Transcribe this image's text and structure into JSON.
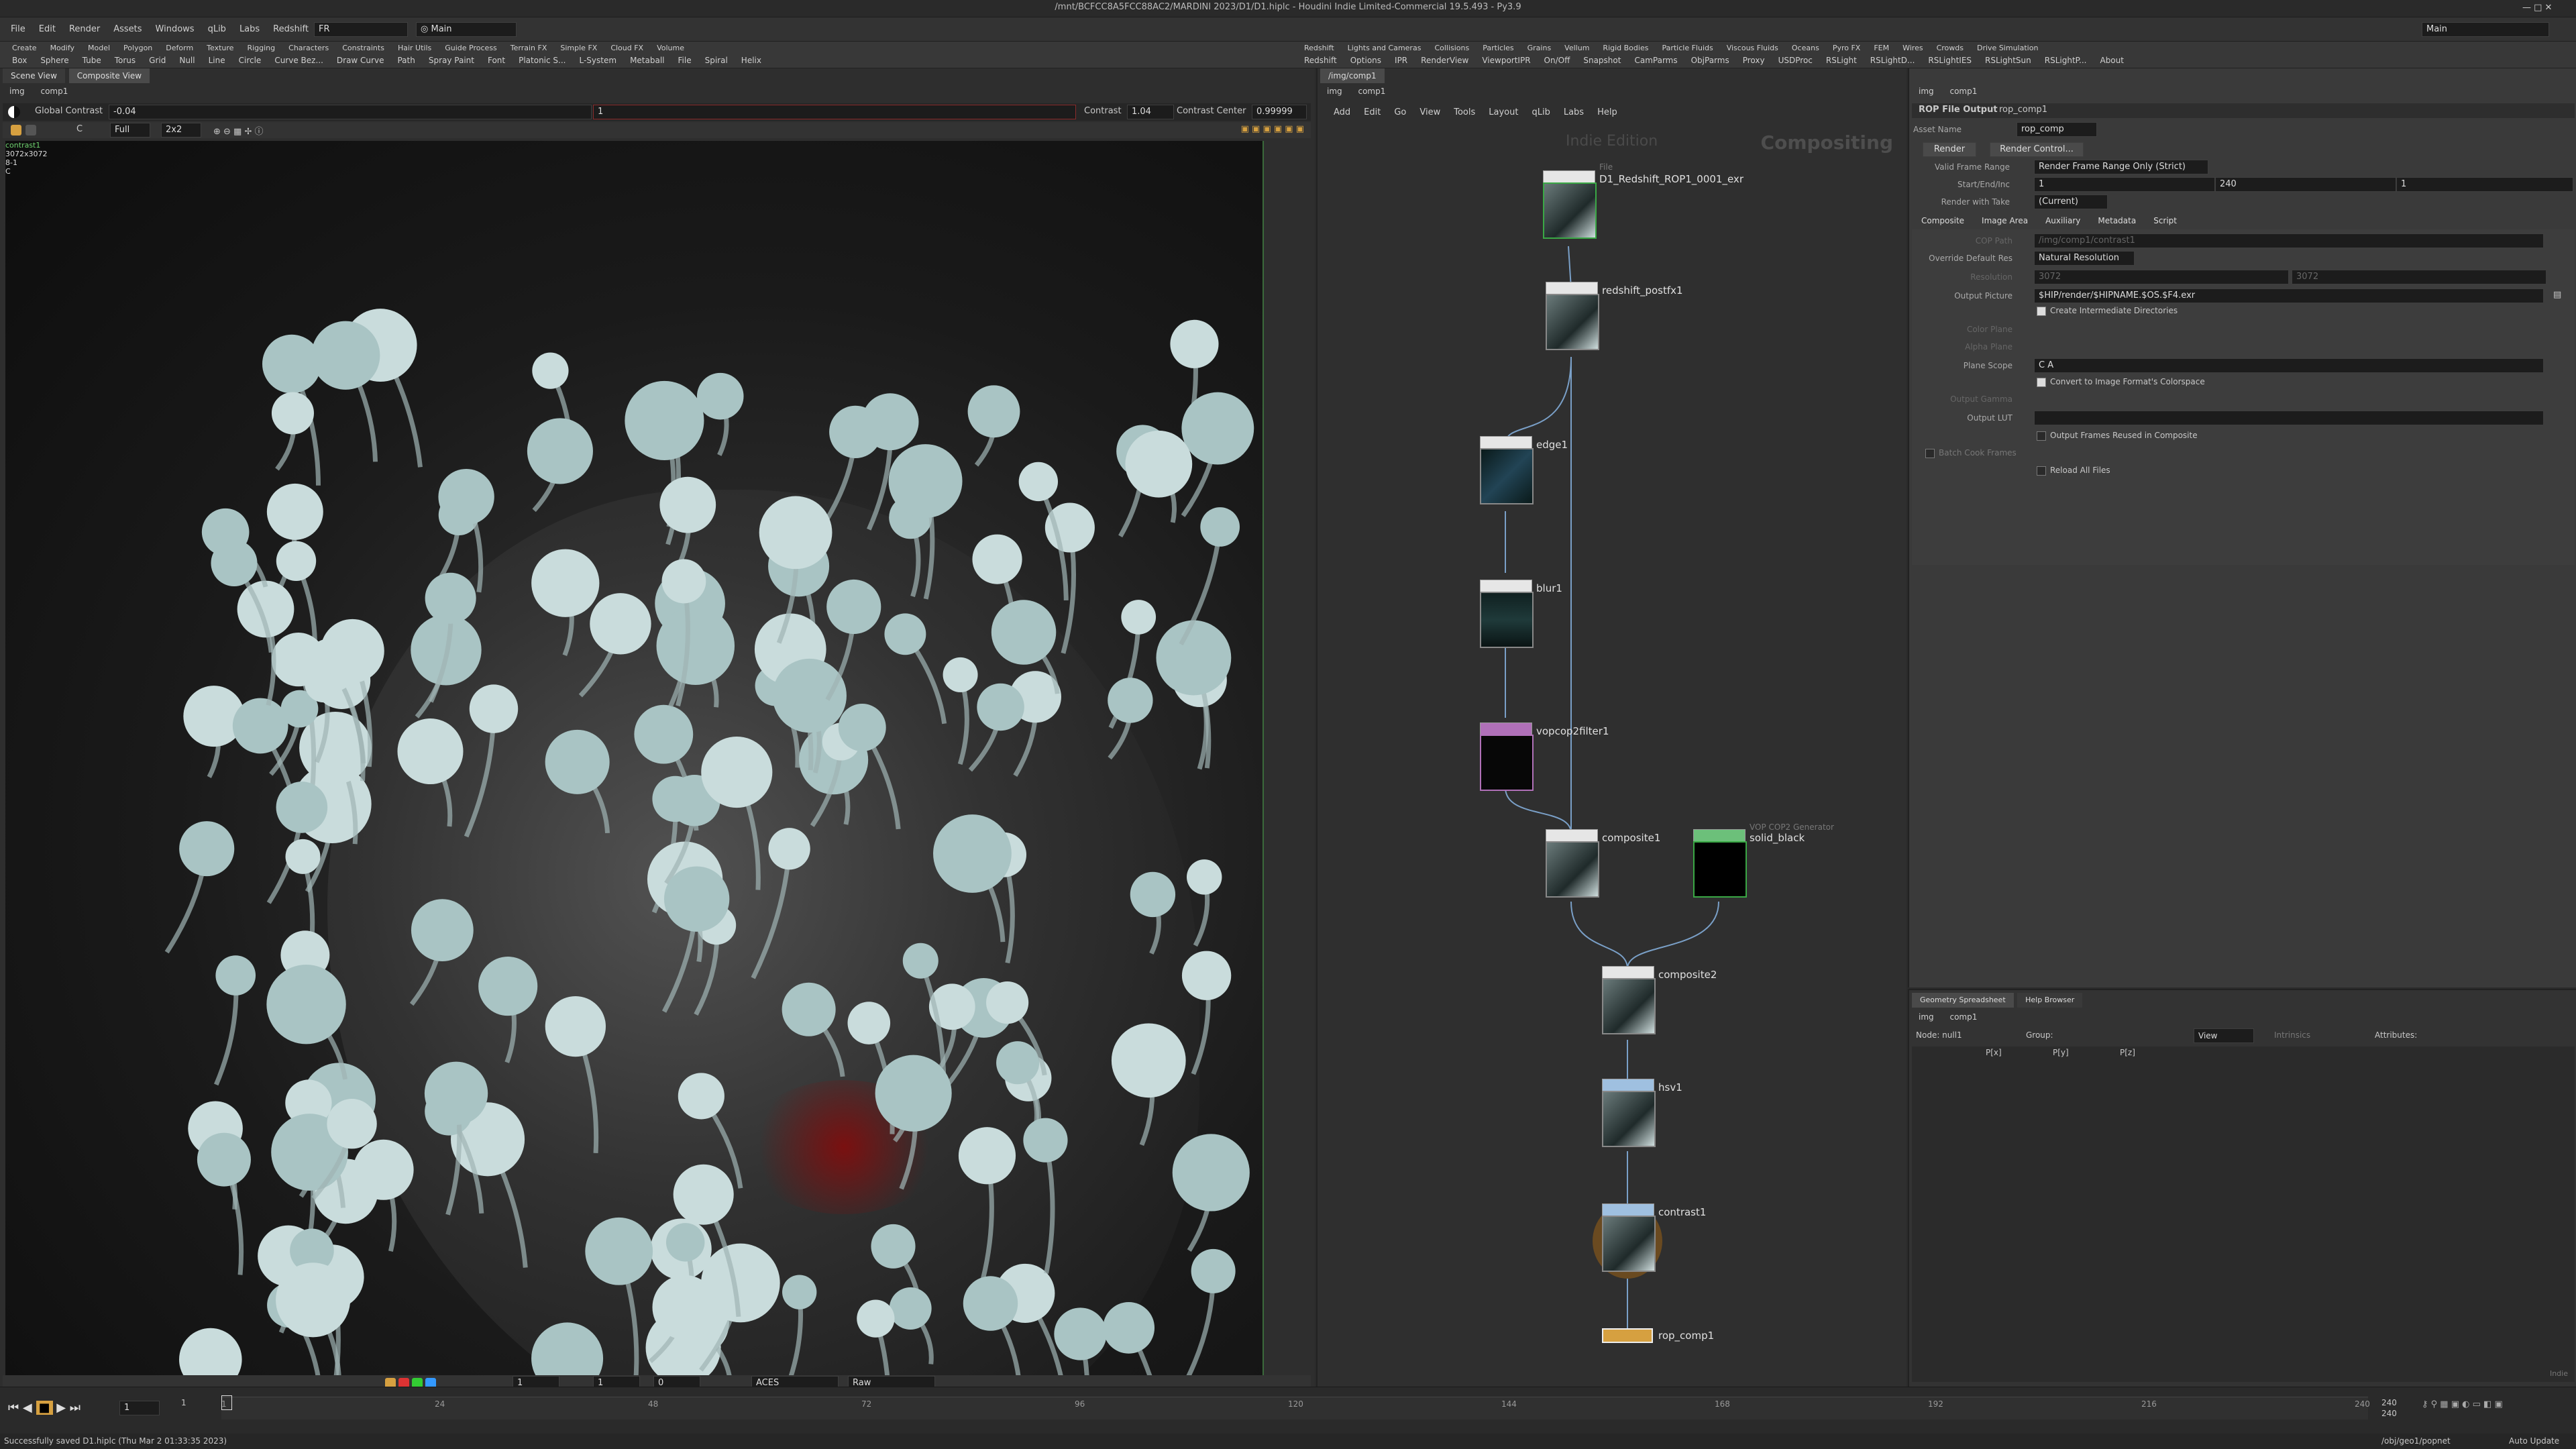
{
  "window": {
    "title": "/mnt/BCFCC8A5FCC88AC2/MARDINI 2023/D1/D1.hiplc - Houdini Indie Limited-Commercial 19.5.493 - Py3.9"
  },
  "menu": [
    "File",
    "Edit",
    "Render",
    "Assets",
    "Windows",
    "qLib",
    "Labs",
    "Redshift",
    "Help"
  ],
  "desktop": {
    "fr": "FR",
    "main": "Main",
    "right_main": "Main"
  },
  "shelf_tabs_left": [
    "Create",
    "Modify",
    "Model",
    "Polygon",
    "Deform",
    "Texture",
    "Rigging",
    "Characters",
    "Constraints",
    "Hair Utils",
    "Guide Process",
    "Terrain FX",
    "Simple FX",
    "Cloud FX",
    "Volume"
  ],
  "shelf_tools_left": [
    "Box",
    "Sphere",
    "Tube",
    "Torus",
    "Grid",
    "Null",
    "Line",
    "Circle",
    "Curve Bez...",
    "Draw Curve",
    "Path",
    "Spray Paint",
    "Font",
    "Platonic S...",
    "L-System",
    "Metaball",
    "File",
    "Spiral",
    "Helix"
  ],
  "shelf_tabs_right": [
    "Redshift",
    "Lights and Cameras",
    "Collisions",
    "Particles",
    "Grains",
    "Vellum",
    "Rigid Bodies",
    "Particle Fluids",
    "Viscous Fluids",
    "Oceans",
    "Pyro FX",
    "FEM",
    "Wires",
    "Crowds",
    "Drive Simulation"
  ],
  "shelf_tools_right": [
    "Redshift",
    "Options",
    "IPR",
    "RenderView",
    "ViewportIPR",
    "On/Off",
    "Snapshot",
    "CamParms",
    "ObjParms",
    "Proxy",
    "USDProc",
    "RSLight",
    "RSLightD...",
    "RSLightIES",
    "RSLightSun",
    "RSLightP...",
    "About"
  ],
  "viewer": {
    "tabs": [
      "Scene View",
      "Composite View"
    ],
    "path": [
      "img",
      "comp1"
    ],
    "global_contrast_label": "Global Contrast",
    "global_contrast_value": "-0.04",
    "field_value": "1",
    "contrast_label": "Contrast",
    "contrast_value": "1.04",
    "contrast_center_label": "Contrast Center",
    "contrast_center_value": "0.99999",
    "full": "Full",
    "ratio": "2x2",
    "channel": "C",
    "overlay": [
      "contrast1",
      "3072x3072",
      "8-1",
      "C"
    ],
    "footer_frame1": "1",
    "footer_frame2": "1",
    "footer_frame3": "0",
    "colorspace": "ACES",
    "view": "Raw"
  },
  "network": {
    "tabs": [
      "/img/comp1"
    ],
    "path": [
      "img",
      "comp1"
    ],
    "menu": [
      "Add",
      "Edit",
      "Go",
      "View",
      "Tools",
      "Layout",
      "qLib",
      "Labs",
      "Help"
    ],
    "watermark_left": "Indie Edition",
    "watermark_right": "Compositing",
    "nodes": [
      {
        "name": "D1_Redshift_ROP1_0001_exr",
        "sub": "File"
      },
      {
        "name": "redshift_postfx1"
      },
      {
        "name": "edge1"
      },
      {
        "name": "blur1"
      },
      {
        "name": "vopcop2filter1"
      },
      {
        "name": "composite1"
      },
      {
        "name": "solid_black",
        "sub": "VOP COP2 Generator"
      },
      {
        "name": "composite2"
      },
      {
        "name": "hsv1"
      },
      {
        "name": "contrast1"
      },
      {
        "name": "rop_comp1"
      }
    ]
  },
  "params": {
    "path": [
      "img",
      "comp1"
    ],
    "type": "ROP File Output",
    "name": "rop_comp1",
    "asset_name_label": "Asset Name",
    "asset_name": "rop_comp",
    "render": "Render",
    "render_control": "Render Control...",
    "valid_frame_range_label": "Valid Frame Range",
    "valid_frame_range": "Render Frame Range Only (Strict)",
    "start_end_inc_label": "Start/End/Inc",
    "start": "1",
    "end": "240",
    "inc": "1",
    "render_with_take_label": "Render with Take",
    "render_with_take": "(Current)",
    "tabs": [
      "Composite",
      "Image Area",
      "Auxiliary",
      "Metadata",
      "Script"
    ],
    "cop_path_label": "COP Path",
    "cop_path": "/img/comp1/contrast1",
    "override_label": "Override Default Res",
    "override": "Natural Resolution",
    "resolution_label": "Resolution",
    "res_x": "3072",
    "res_y": "3072",
    "output_picture_label": "Output Picture",
    "output_picture": "$HIP/render/$HIPNAME.$OS.$F4.exr",
    "create_dirs": "Create Intermediate Directories",
    "color_plane_label": "Color Plane",
    "alpha_plane_label": "Alpha Plane",
    "plane_scope_label": "Plane Scope",
    "plane_scope": "C A",
    "convert": "Convert to Image Format's Colorspace",
    "output_gamma_label": "Output Gamma",
    "output_lut_label": "Output LUT",
    "output_frames": "Output Frames Reused in Composite",
    "batch_label": "Batch Cook Frames",
    "reload": "Reload All Files"
  },
  "spreadsheet": {
    "tabs": [
      "Geometry Spreadsheet",
      "Help Browser"
    ],
    "path": [
      "img",
      "comp1"
    ],
    "node_label": "Node: null1",
    "group_label": "Group:",
    "view": "View",
    "intrinsics": "Intrinsics",
    "attributes": "Attributes:",
    "cols": [
      "P[x]",
      "P[y]",
      "P[z]"
    ]
  },
  "timeline": {
    "ticks": [
      "1",
      "24",
      "48",
      "72",
      "96",
      "120",
      "144",
      "168",
      "192",
      "216",
      "240"
    ],
    "current": "1",
    "start": "1",
    "end": "240",
    "end2": "240",
    "end3": "240",
    "autoupdate": "Auto Update"
  },
  "status": {
    "message": "Successfully saved D1.hiplc (Thu Mar 2 01:33:35 2023)",
    "path": "/obj/geo1/popnet"
  },
  "indie": "Indie"
}
